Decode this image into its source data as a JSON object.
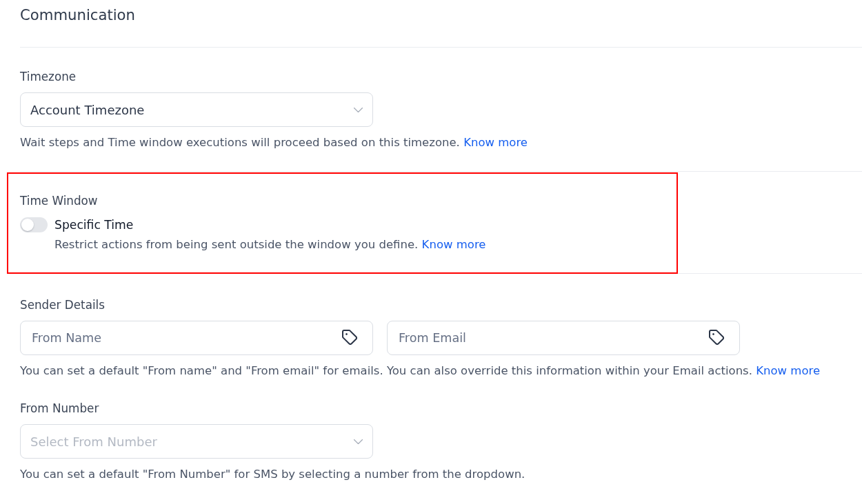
{
  "page": {
    "title": "Communication"
  },
  "timezone": {
    "label": "Timezone",
    "value": "Account Timezone",
    "help": "Wait steps and Time window executions will proceed based on this timezone.",
    "link": "Know more"
  },
  "time_window": {
    "label": "Time Window",
    "highlighted": true,
    "option": {
      "label": "Specific Time",
      "on": false,
      "description": "Restrict actions from being sent outside the window you define.",
      "link": "Know more"
    }
  },
  "sender_details": {
    "label": "Sender Details",
    "fields": [
      {
        "placeholder": "From Name"
      },
      {
        "placeholder": "From Email"
      }
    ],
    "help": "You can set a default \"From name\" and \"From email\" for emails. You can also override this information within your Email actions.",
    "link": "Know more"
  },
  "from_number": {
    "label": "From Number",
    "placeholder": "Select From Number",
    "help": "You can set a default \"From Number\" for SMS by selecting a number from the dropdown."
  }
}
